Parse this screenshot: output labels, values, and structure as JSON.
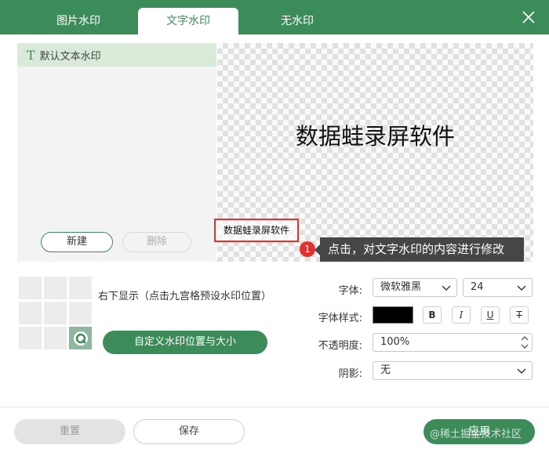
{
  "tabs": [
    {
      "label": "图片水印",
      "active": false
    },
    {
      "label": "文字水印",
      "active": true
    },
    {
      "label": "无水印",
      "active": false
    }
  ],
  "list": {
    "item_icon": "text-t-icon",
    "item_label": "默认文本水印",
    "new_label": "新建",
    "delete_label": "删除"
  },
  "preview": {
    "main_text": "数据蛙录屏软件",
    "watermark_text": "数据蛙录屏软件"
  },
  "tooltip": {
    "step": "1",
    "text": "点击，对文字水印的内容进行修改"
  },
  "position": {
    "text": "右下显示（点击九宫格预设水印位置）",
    "custom_button": "自定义水印位置与大小"
  },
  "font": {
    "label": "字体:",
    "family": "微软雅黑",
    "size": "24"
  },
  "style": {
    "label": "字体样式:",
    "color": "#000000",
    "bold": "B",
    "italic": "I",
    "underline": "U",
    "strike": "T"
  },
  "opacity": {
    "label": "不透明度:",
    "value": "100%"
  },
  "shadow": {
    "label": "阴影:",
    "value": "无"
  },
  "footer": {
    "reset_label": "重置",
    "save_label": "保存",
    "apply_label": "应用",
    "overlay_watermark": "@稀土掘金技术社区"
  },
  "colors": {
    "accent": "#3c8c5a",
    "highlight": "#e03030",
    "tooltip_bg": "#464646"
  }
}
